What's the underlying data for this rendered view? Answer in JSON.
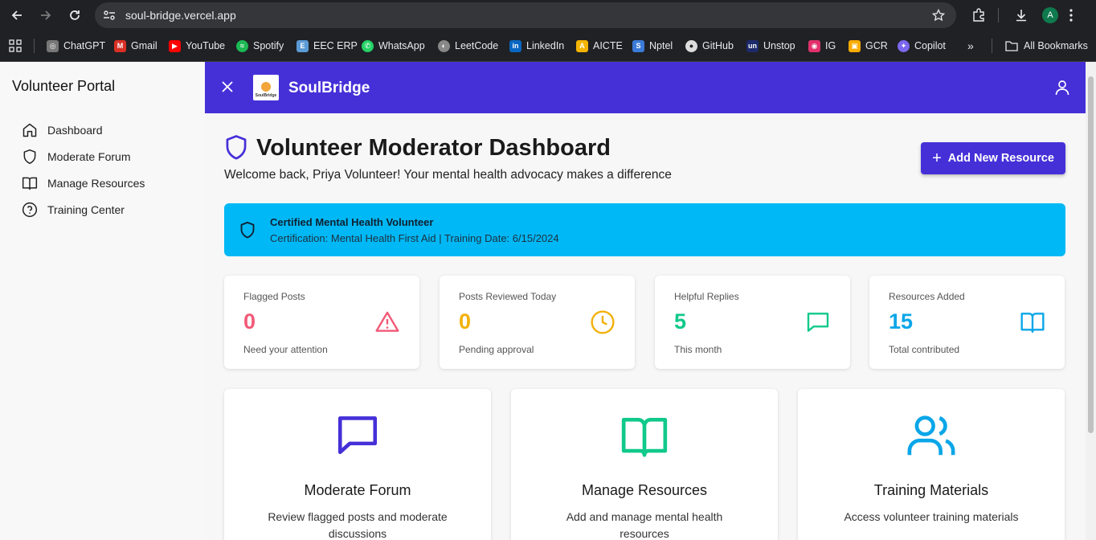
{
  "browser": {
    "url": "soul-bridge.vercel.app",
    "profile_initial": "A",
    "bookmarks": [
      {
        "label": "ChatGPT",
        "color": "#777777"
      },
      {
        "label": "Gmail",
        "color": "#d93025"
      },
      {
        "label": "YouTube",
        "color": "#ff0000"
      },
      {
        "label": "Spotify",
        "color": "#1db954"
      },
      {
        "label": "EEC ERP",
        "color": "#5b9bd5"
      },
      {
        "label": "WhatsApp",
        "color": "#25d366"
      },
      {
        "label": "LeetCode",
        "color": "#888888"
      },
      {
        "label": "LinkedIn",
        "color": "#0a66c2"
      },
      {
        "label": "AICTE",
        "color": "#f4b400"
      },
      {
        "label": "Nptel",
        "color": "#3c7bd8"
      },
      {
        "label": "GitHub",
        "color": "#dddddd"
      },
      {
        "label": "Unstop",
        "color": "#1c2a6b"
      },
      {
        "label": "IG",
        "color": "#e1306c"
      },
      {
        "label": "GCR",
        "color": "#f9ab00"
      },
      {
        "label": "Copilot",
        "color": "#7b68ee"
      }
    ],
    "all_bookmarks": "All Bookmarks"
  },
  "sidebar": {
    "title": "Volunteer Portal",
    "items": [
      {
        "label": "Dashboard",
        "icon": "home-icon"
      },
      {
        "label": "Moderate Forum",
        "icon": "shield-icon"
      },
      {
        "label": "Manage Resources",
        "icon": "book-icon"
      },
      {
        "label": "Training Center",
        "icon": "help-circle-icon"
      }
    ]
  },
  "header": {
    "brand": "SoulBridge",
    "logo_text": "SoulBridge"
  },
  "main": {
    "title": "Volunteer Moderator Dashboard",
    "welcome": "Welcome back, Priya Volunteer! Your mental health advocacy makes a difference",
    "add_button": "Add New Resource",
    "cert": {
      "title": "Certified Mental Health Volunteer",
      "detail": "Certification: Mental Health First Aid | Training Date: 6/15/2024"
    },
    "stats": [
      {
        "label": "Flagged Posts",
        "value": "0",
        "sub": "Need your attention",
        "color": "#f25a78",
        "icon": "alert-triangle-icon"
      },
      {
        "label": "Posts Reviewed Today",
        "value": "0",
        "sub": "Pending approval",
        "color": "#f2b10a",
        "icon": "clock-icon"
      },
      {
        "label": "Helpful Replies",
        "value": "5",
        "sub": "This month",
        "color": "#10c98a",
        "icon": "message-square-icon"
      },
      {
        "label": "Resources Added",
        "value": "15",
        "sub": "Total contributed",
        "color": "#0aa6e8",
        "icon": "book-open-icon"
      }
    ],
    "cards": [
      {
        "title": "Moderate Forum",
        "desc": "Review flagged posts and moderate discussions",
        "color": "#4530d8",
        "icon": "message-square-icon"
      },
      {
        "title": "Manage Resources",
        "desc": "Add and manage mental health resources",
        "color": "#10c98a",
        "icon": "book-open-icon"
      },
      {
        "title": "Training Materials",
        "desc": "Access volunteer training materials",
        "color": "#0aa6e8",
        "icon": "users-icon"
      }
    ]
  }
}
